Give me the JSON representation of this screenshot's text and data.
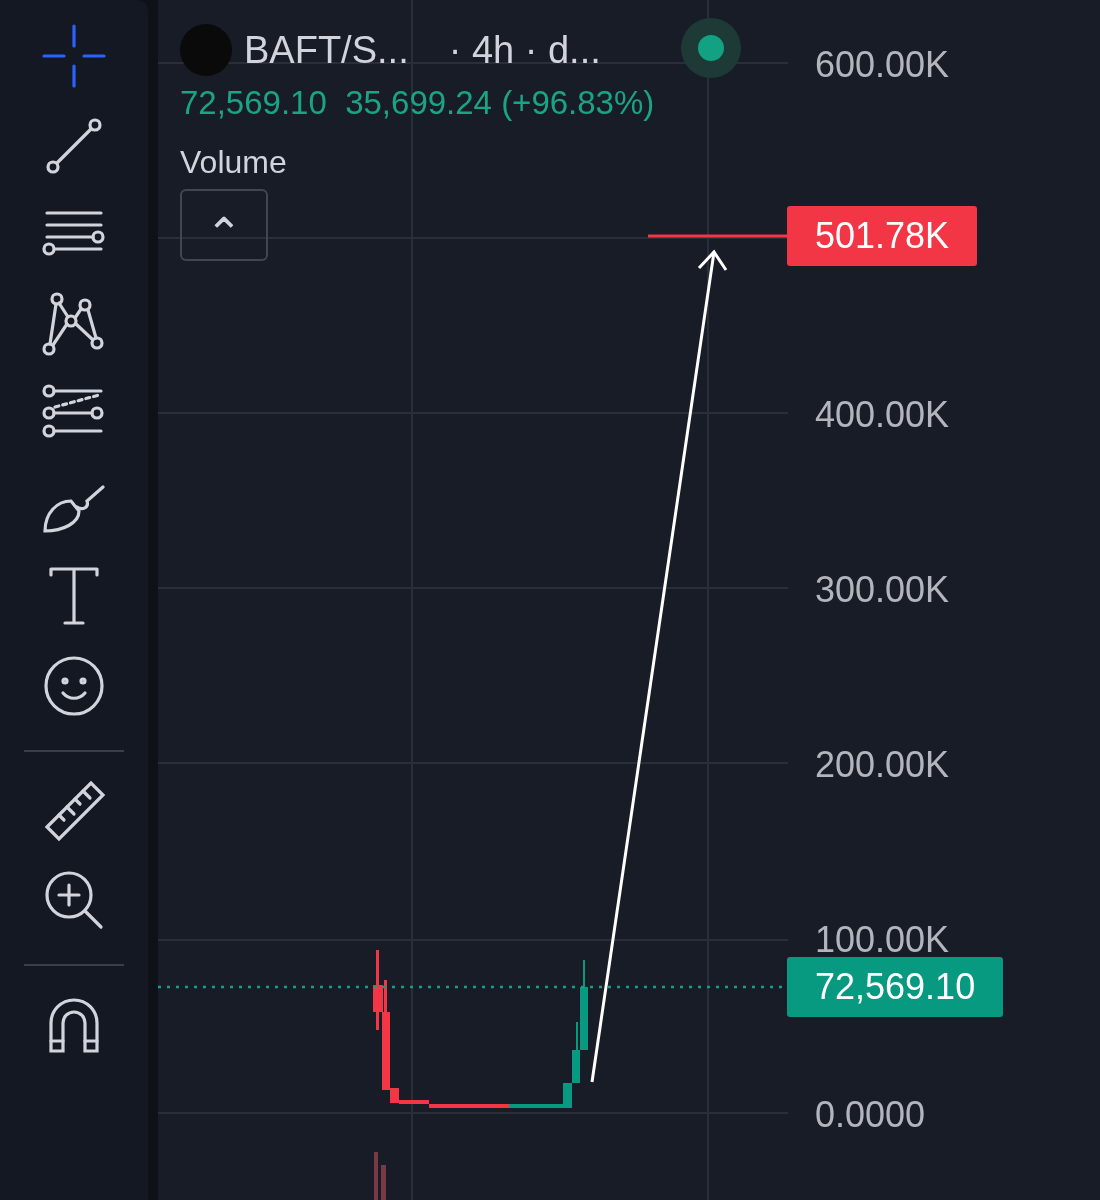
{
  "toolbar": {
    "groups": [
      [
        {
          "selected": true
        },
        {
          "selected": false
        },
        {
          "selected": false
        },
        {
          "selected": false
        },
        {
          "selected": false
        },
        {
          "selected": false
        },
        {
          "selected": false
        },
        {
          "selected": false
        }
      ],
      [
        {
          "selected": false
        },
        {
          "selected": false
        }
      ],
      [
        {
          "selected": false
        }
      ]
    ]
  },
  "legend": {
    "symbol": "BAFT/S...",
    "interval": "· 4h · d...",
    "price": "72,569.10",
    "change": "35,699.24 (+96.83%)",
    "indicator": "Volume",
    "collapse_icon": "⌃"
  },
  "price_axis": {
    "labels": [
      "600.00K",
      "400.00K",
      "300.00K",
      "200.00K",
      "100.00K",
      "0.0000"
    ]
  },
  "price_labels": [
    {
      "kind": "drawing",
      "text": "501.78K",
      "color": "#f23645"
    },
    {
      "kind": "last",
      "text": "72,569.10",
      "color": "#089981"
    }
  ]
}
